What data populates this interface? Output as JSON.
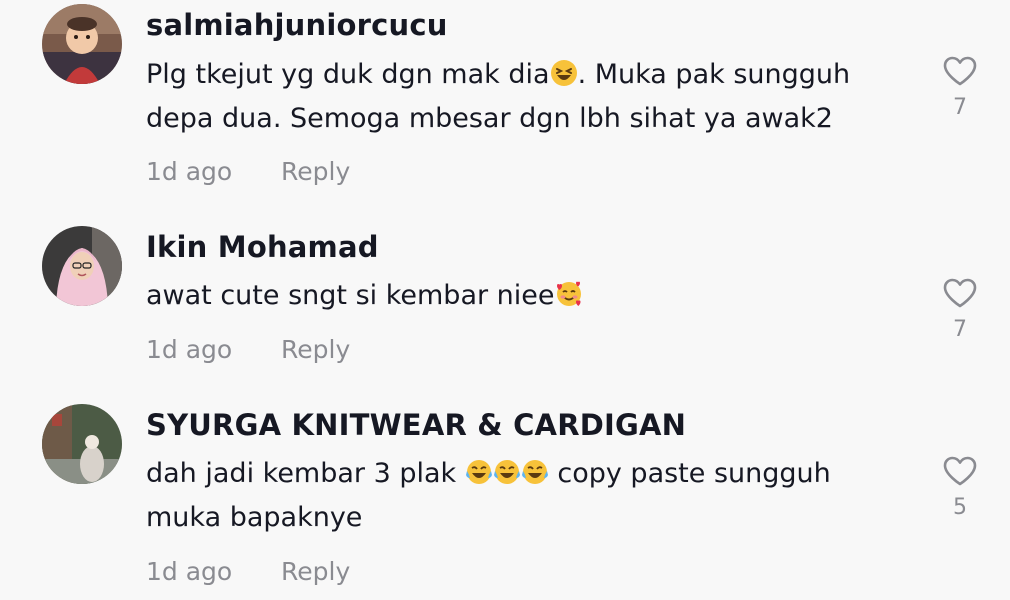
{
  "comments": [
    {
      "username": "salmiahjuniorcucu",
      "text_before": "Plg tkejut yg duk dgn mak dia",
      "text_after": ". Muka pak sungguh depa dua. Semoga mbesar dgn lbh sihat ya awak2",
      "emoji": "laughing-squint-emoji",
      "time": "1d ago",
      "reply_label": "Reply",
      "likes": "7"
    },
    {
      "username": "Ikin Mohamad",
      "text_before": "awat cute sngt si kembar niee",
      "text_after": "",
      "emoji": "smiling-face-with-hearts-emoji",
      "time": "1d ago",
      "reply_label": "Reply",
      "likes": "7"
    },
    {
      "username": "SYURGA KNITWEAR & CARDIGAN",
      "text_before": "dah jadi kembar 3 plak ",
      "text_after": " copy paste sungguh muka bapaknye",
      "emoji": "tears-of-joy-emoji",
      "emoji_count": 3,
      "time": "1d ago",
      "reply_label": "Reply",
      "likes": "5"
    }
  ],
  "icons": {
    "like": "heart-outline-icon"
  },
  "colors": {
    "background": "#f8f8f8",
    "text": "#161823",
    "muted": "#8a8b91"
  }
}
